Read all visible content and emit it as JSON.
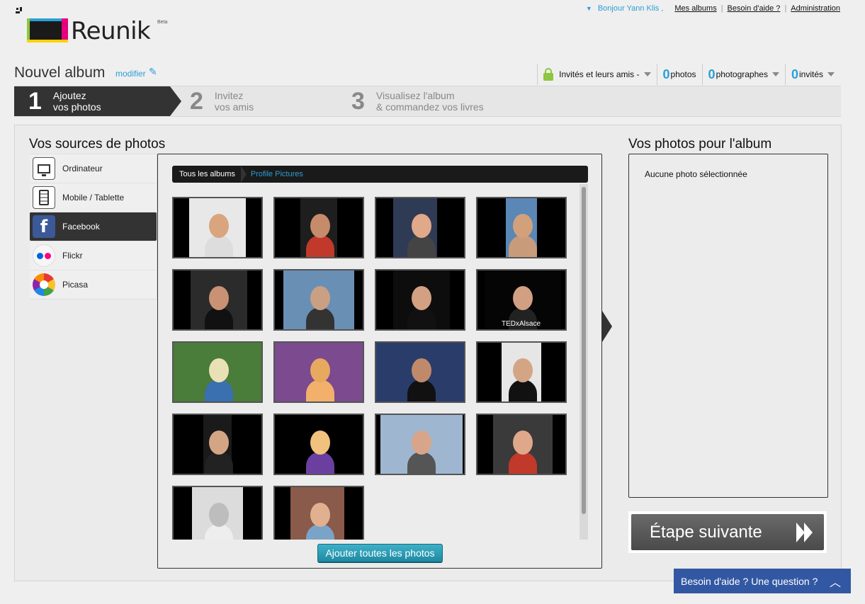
{
  "brand": {
    "name": "Reunik",
    "beta": "Beta"
  },
  "topnav": {
    "greeting": "Bonjour Yann Klis ,",
    "links": [
      "Mes albums",
      "Besoin d'aide ?",
      "Administration"
    ]
  },
  "album": {
    "title": "Nouvel album",
    "edit_label": "modifier",
    "privacy": "Invités et leurs amis -",
    "photos_count": "0",
    "photos_label": "photos",
    "photographers_count": "0",
    "photographers_label": "photographes",
    "guests_count": "0",
    "guests_label": "invités"
  },
  "steps": [
    {
      "num": "1",
      "label": "Ajoutez\nvos photos"
    },
    {
      "num": "2",
      "label": "Invitez\nvos amis"
    },
    {
      "num": "3",
      "label": "Visualisez l'album\n& commandez vos livres"
    }
  ],
  "sources": {
    "title": "Vos sources de photos",
    "items": [
      {
        "label": "Ordinateur",
        "icon": "computer-icon"
      },
      {
        "label": "Mobile / Tablette",
        "icon": "mobile-icon"
      },
      {
        "label": "Facebook",
        "icon": "facebook-icon",
        "active": true
      },
      {
        "label": "Flickr",
        "icon": "flickr-icon"
      },
      {
        "label": "Picasa",
        "icon": "picasa-icon"
      }
    ]
  },
  "browser": {
    "breadcrumb_root": "Tous les albums",
    "breadcrumb_current": "Profile Pictures",
    "add_all_label": "Ajouter toutes les photos",
    "thumb_count": 18
  },
  "selection": {
    "title": "Vos photos pour l'album",
    "empty": "Aucune photo sélectionnée"
  },
  "next_label": "Étape suivante",
  "help_label": "Besoin d'aide ? Une question ?",
  "tedx_text": "TEDxAlsace",
  "colors": {
    "accent": "#2a9fd6",
    "dark": "#333333",
    "help": "#3358a3"
  }
}
